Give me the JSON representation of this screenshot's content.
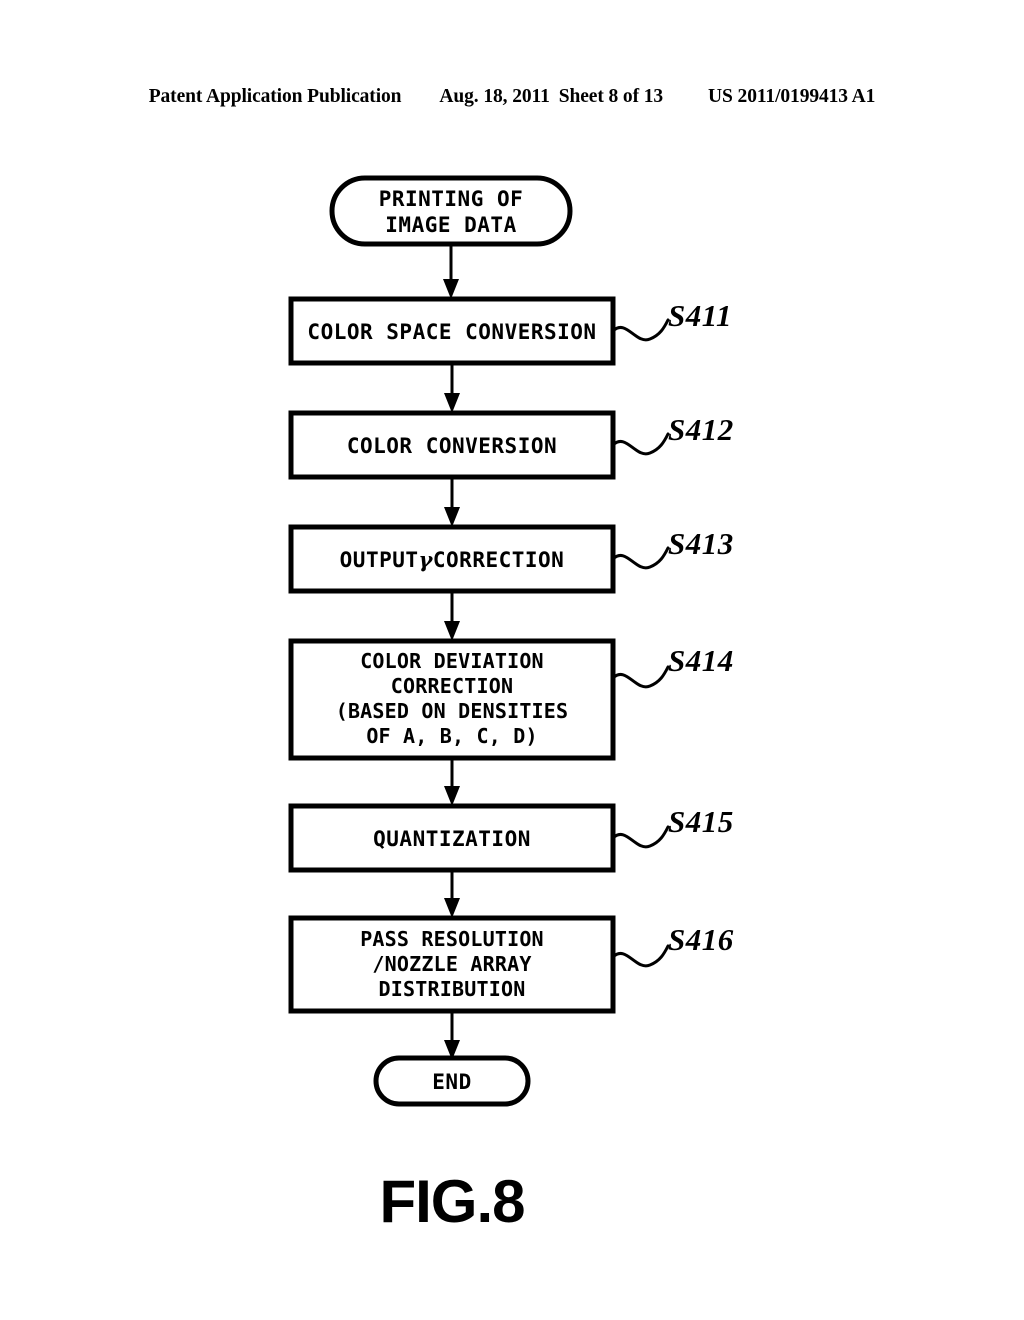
{
  "header": {
    "publication": "Patent Application Publication",
    "date": "Aug. 18, 2011",
    "sheet": "Sheet 8 of 13",
    "number": "US 2011/0199413 A1"
  },
  "figure": {
    "caption": "FIG.8",
    "start_node": {
      "shape": "stadium",
      "lines": [
        "PRINTING OF",
        "IMAGE DATA"
      ]
    },
    "end_node": {
      "shape": "stadium",
      "lines": [
        "END"
      ]
    },
    "steps": [
      {
        "id": "S411",
        "label": "S411",
        "lines": [
          "COLOR SPACE CONVERSION"
        ]
      },
      {
        "id": "S412",
        "label": "S412",
        "lines": [
          "COLOR CONVERSION"
        ]
      },
      {
        "id": "S413",
        "label": "S413",
        "lines": [
          "OUTPUT γ CORRECTION"
        ],
        "pre_gamma": "OUTPUT",
        "gamma": "γ",
        "post_gamma": "CORRECTION"
      },
      {
        "id": "S414",
        "label": "S414",
        "lines": [
          "COLOR DEVIATION",
          "CORRECTION",
          "(BASED ON DENSITIES",
          "OF A, B, C, D)"
        ]
      },
      {
        "id": "S415",
        "label": "S415",
        "lines": [
          "QUANTIZATION"
        ]
      },
      {
        "id": "S416",
        "label": "S416",
        "lines": [
          "PASS RESOLUTION",
          "/NOZZLE ARRAY",
          "DISTRIBUTION"
        ]
      }
    ]
  },
  "colors": {
    "ink": "#000000",
    "paper": "#ffffff"
  }
}
